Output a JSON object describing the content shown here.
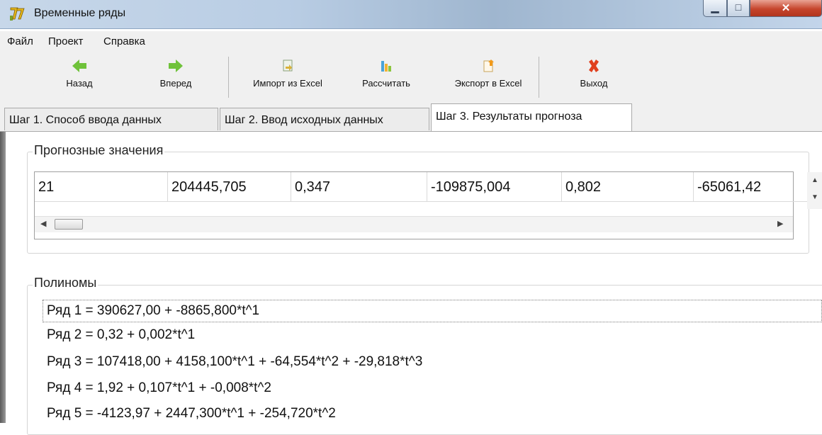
{
  "window": {
    "title": "Временные ряды"
  },
  "menu": [
    "Файл",
    "Проект",
    "Справка"
  ],
  "toolbar": {
    "back": "Назад",
    "forward": "Вперед",
    "import_excel": "Импорт из Excel",
    "calculate": "Рассчитать",
    "export_excel": "Экспорт в Excel",
    "exit": "Выход"
  },
  "tabs": [
    {
      "label": "Шаг 1. Способ ввода данных",
      "active": false
    },
    {
      "label": "Шаг 2. Ввод исходных данных",
      "active": false
    },
    {
      "label": "Шаг 3. Результаты прогноза",
      "active": true
    }
  ],
  "forecast": {
    "title": "Прогнозные значения",
    "row": [
      "21",
      "204445,705",
      "0,347",
      "-109875,004",
      "0,802",
      "-65061,42"
    ]
  },
  "polynomials": {
    "title": "Полиномы",
    "items": [
      "Ряд 1 = 390627,00 + -8865,800*t^1",
      "Ряд 2 = 0,32 + 0,002*t^1",
      "Ряд 3 = 107418,00 + 4158,100*t^1 + -64,554*t^2 + -29,818*t^3",
      "Ряд 4 = 1,92 + 0,107*t^1 + -0,008*t^2",
      "Ряд 5 = -4123,97 + 2447,300*t^1 + -254,720*t^2"
    ]
  },
  "colors": {
    "titlebar": "#b9cde4",
    "close": "#c6452c",
    "arrow_green": "#6fc23a",
    "exit_red": "#e0401e"
  }
}
